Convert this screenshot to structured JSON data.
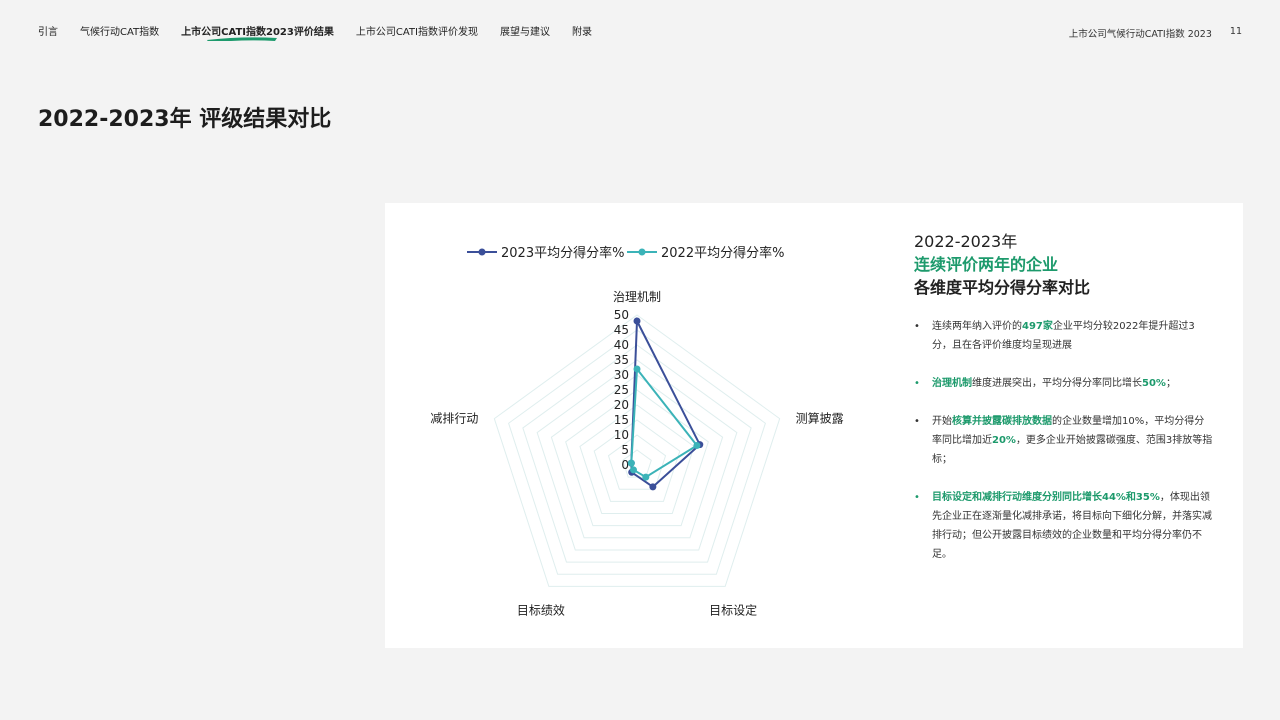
{
  "nav": {
    "items": [
      "引言",
      "气候行动CAT指数",
      "上市公司CATI指数2023评价结果",
      "上市公司CATI指数评价发现",
      "展望与建议",
      "附录"
    ],
    "active_index": 2
  },
  "header": {
    "doc_title": "上市公司气候行动CATI指数 2023",
    "page_number": "11"
  },
  "page_title": "2022-2023年 评级结果对比",
  "colors": {
    "series_2023": "#3b4f99",
    "series_2022": "#3bb3b8",
    "accent": "#1d9a6c",
    "grid": "#dfeeee"
  },
  "side": {
    "heading_line1": "2022-2023年",
    "heading_line2": "连续评价两年的企业",
    "heading_line3": "各维度平均分得分率对比",
    "b1": {
      "t1": "连续两年纳入评价的",
      "h1": "497家",
      "t2": "企业平均分较2022年提升超过3分，且在各评价维度均呈现进展"
    },
    "b2": {
      "h1": "治理机制",
      "t1": "维度进展突出，平均分得分率同比增长",
      "h2": "50%",
      "t2": "；"
    },
    "b3": {
      "t1": "开始",
      "h1": "核算并披露碳排放数据",
      "t2": "的企业数量增加10%，平均分得分率同比增加近",
      "h2": "20%",
      "t3": "，更多企业开始披露碳强度、范围3排放等指标；"
    },
    "b4": {
      "h1": "目标设定和减排行动维度分别同比增长44%和35%",
      "t1": "，体现出领先企业正在逐渐量化减排承诺，将目标向下细化分解，并落实减排行动；但公开披露目标绩效的企业数量和平均分得分率仍不足。"
    }
  },
  "chart_data": {
    "type": "radar",
    "axes": [
      "治理机制",
      "测算披露",
      "目标设定",
      "目标绩效",
      "减排行动"
    ],
    "series": [
      {
        "name": "2023平均分得分率%",
        "values": [
          48,
          22,
          9,
          3,
          2
        ]
      },
      {
        "name": "2022平均分得分率%",
        "values": [
          32,
          21,
          5,
          2,
          2
        ]
      }
    ],
    "ticks": [
      "50",
      "45",
      "40",
      "35",
      "30",
      "25",
      "20",
      "15",
      "10",
      "5",
      "0"
    ],
    "rmax": 50,
    "legend_position": "top"
  }
}
